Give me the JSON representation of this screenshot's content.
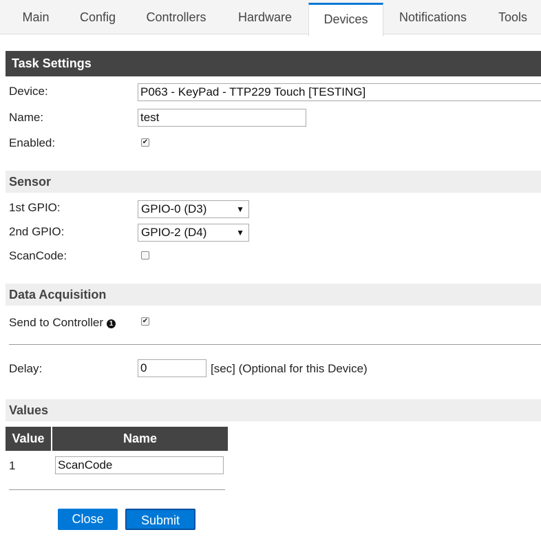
{
  "tabs": [
    {
      "label": "Main"
    },
    {
      "label": "Config"
    },
    {
      "label": "Controllers"
    },
    {
      "label": "Hardware"
    },
    {
      "label": "Devices",
      "active": true
    },
    {
      "label": "Notifications"
    },
    {
      "label": "Tools"
    }
  ],
  "task_settings": {
    "title": "Task Settings",
    "device_label": "Device:",
    "device_value": "P063 - KeyPad - TTP229 Touch [TESTING]",
    "name_label": "Name:",
    "name_value": "test",
    "enabled_label": "Enabled:",
    "enabled_checked": true
  },
  "sensor": {
    "title": "Sensor",
    "gpio1_label": "1st GPIO:",
    "gpio1_value": "GPIO-0 (D3)",
    "gpio2_label": "2nd GPIO:",
    "gpio2_value": "GPIO-2 (D4)",
    "scancode_label": "ScanCode:",
    "scancode_checked": false
  },
  "data_acquisition": {
    "title": "Data Acquisition",
    "send_label": "Send to Controller",
    "send_badge": "1",
    "send_checked": true,
    "delay_label": "Delay:",
    "delay_value": "0",
    "delay_note": "[sec] (Optional for this Device)"
  },
  "values": {
    "title": "Values",
    "col_value": "Value",
    "col_name": "Name",
    "rows": [
      {
        "index": "1",
        "name": "ScanCode"
      }
    ]
  },
  "buttons": {
    "close": "Close",
    "submit": "Submit"
  },
  "icons": {
    "dropdown": "▼",
    "check": "✔",
    "info": "info-badge-icon"
  },
  "colors": {
    "accent": "#0078d7",
    "header_dark": "#444444",
    "header_light": "#eeeeee"
  }
}
